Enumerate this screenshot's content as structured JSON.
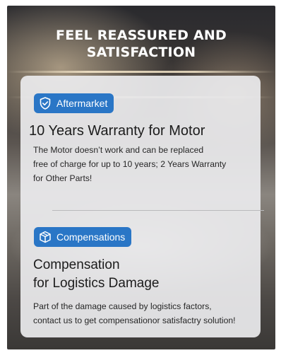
{
  "headline": {
    "line1": "FEEL REASSURED AND",
    "line2": "SATISFACTION"
  },
  "sections": [
    {
      "badge_label": "Aftermarket",
      "badge_icon": "shield-check-icon",
      "title": "10 Years Warranty for Motor",
      "body_lines": [
        "The Motor doesn’t work and can be replaced",
        "free of charge for up to 10 years; 2 Years Warranty",
        "for Other Parts!"
      ]
    },
    {
      "badge_label": "Compensations",
      "badge_icon": "package-box-icon",
      "title_lines": [
        "Compensation",
        "for Logistics Damage"
      ],
      "body_lines": [
        "Part of the damage caused by logistics factors,",
        "contact us to get compensationor satisfactry solution!"
      ]
    }
  ],
  "colors": {
    "badge": "#2a76c6",
    "card": "#ececee",
    "headline": "#ffffff"
  }
}
